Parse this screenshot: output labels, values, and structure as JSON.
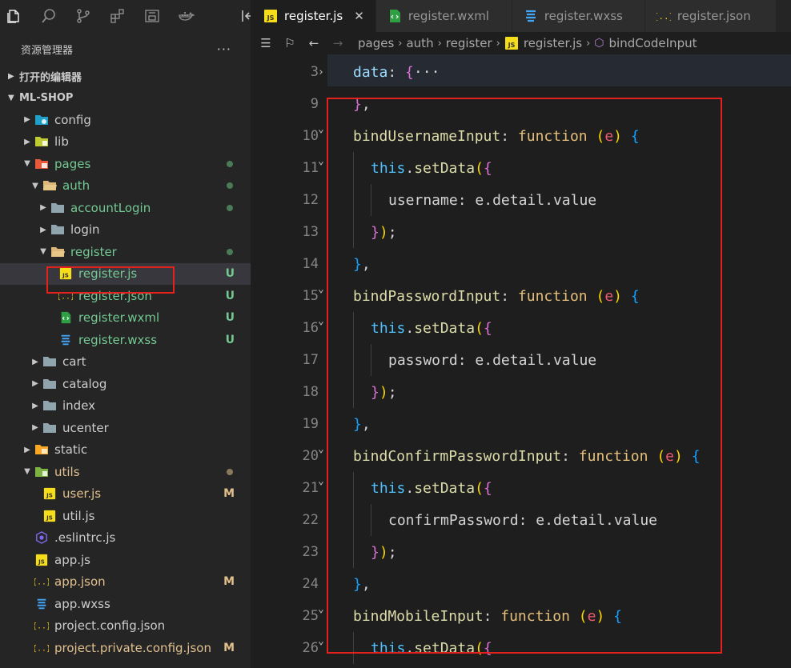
{
  "sidebar": {
    "title": "资源管理器",
    "more": "···",
    "open_editors": "打开的编辑器",
    "project": "ML-SHOP",
    "tree": [
      {
        "label": "config",
        "depth": 0,
        "chev": "▶",
        "icon": "folder-config-icon",
        "color": "plain"
      },
      {
        "label": "lib",
        "depth": 0,
        "chev": "▶",
        "icon": "folder-lib-icon",
        "color": "plain"
      },
      {
        "label": "pages",
        "depth": 0,
        "chev": "▼",
        "icon": "folder-pages-icon",
        "color": "green",
        "status": "dot"
      },
      {
        "label": "auth",
        "depth": 1,
        "chev": "▼",
        "icon": "folder-open-icon",
        "color": "green",
        "status": "dot"
      },
      {
        "label": "accountLogin",
        "depth": 2,
        "chev": "▶",
        "icon": "folder-icon",
        "color": "green",
        "status": "dot"
      },
      {
        "label": "login",
        "depth": 2,
        "chev": "▶",
        "icon": "folder-icon",
        "color": "plain"
      },
      {
        "label": "register",
        "depth": 2,
        "chev": "▼",
        "icon": "folder-open-icon",
        "color": "green",
        "status": "dot"
      },
      {
        "label": "register.js",
        "depth": 3,
        "chev": "",
        "icon": "js-file-icon",
        "color": "green",
        "status": "U",
        "selected": true
      },
      {
        "label": "register.json",
        "depth": 3,
        "chev": "",
        "icon": "json-file-icon",
        "color": "green",
        "status": "U"
      },
      {
        "label": "register.wxml",
        "depth": 3,
        "chev": "",
        "icon": "wxml-file-icon",
        "color": "green",
        "status": "U"
      },
      {
        "label": "register.wxss",
        "depth": 3,
        "chev": "",
        "icon": "css-file-icon",
        "color": "green",
        "status": "U"
      },
      {
        "label": "cart",
        "depth": 1,
        "chev": "▶",
        "icon": "folder-icon",
        "color": "plain"
      },
      {
        "label": "catalog",
        "depth": 1,
        "chev": "▶",
        "icon": "folder-icon",
        "color": "plain"
      },
      {
        "label": "index",
        "depth": 1,
        "chev": "▶",
        "icon": "folder-icon",
        "color": "plain"
      },
      {
        "label": "ucenter",
        "depth": 1,
        "chev": "▶",
        "icon": "folder-icon",
        "color": "plain"
      },
      {
        "label": "static",
        "depth": 0,
        "chev": "▶",
        "icon": "folder-static-icon",
        "color": "plain"
      },
      {
        "label": "utils",
        "depth": 0,
        "chev": "▼",
        "icon": "folder-utils-icon",
        "color": "olive",
        "status": "dot-olive"
      },
      {
        "label": "user.js",
        "depth": 1,
        "chev": "",
        "icon": "js-file-icon",
        "color": "olive",
        "status": "M"
      },
      {
        "label": "util.js",
        "depth": 1,
        "chev": "",
        "icon": "js-file-icon",
        "color": "plain"
      },
      {
        "label": ".eslintrc.js",
        "depth": 0,
        "chev": "",
        "icon": "eslint-icon",
        "color": "plain"
      },
      {
        "label": "app.js",
        "depth": 0,
        "chev": "",
        "icon": "js-file-icon",
        "color": "plain"
      },
      {
        "label": "app.json",
        "depth": 0,
        "chev": "",
        "icon": "json-file-icon",
        "color": "olive",
        "status": "M"
      },
      {
        "label": "app.wxss",
        "depth": 0,
        "chev": "",
        "icon": "css-file-icon",
        "color": "plain"
      },
      {
        "label": "project.config.json",
        "depth": 0,
        "chev": "",
        "icon": "json-file-icon",
        "color": "plain"
      },
      {
        "label": "project.private.config.json",
        "depth": 0,
        "chev": "",
        "icon": "json-file-icon",
        "color": "olive",
        "status": "M"
      }
    ]
  },
  "tabs": [
    {
      "label": "register.js",
      "icon": "js-file-icon",
      "active": true,
      "close": "✕"
    },
    {
      "label": "register.wxml",
      "icon": "wxml-file-icon",
      "active": false
    },
    {
      "label": "register.wxss",
      "icon": "css-file-icon",
      "active": false
    },
    {
      "label": "register.json",
      "icon": "json-file-icon",
      "active": false
    }
  ],
  "breadcrumb": [
    "pages",
    "auth",
    "register",
    "register.js",
    "bindCodeInput"
  ],
  "editor": {
    "lines": [
      {
        "n": "3",
        "fold": "›",
        "indent": 0,
        "tokens": [
          [
            "data",
            "prop"
          ],
          [
            ": ",
            "punc"
          ],
          [
            "{",
            "brace"
          ],
          [
            "···",
            "punc"
          ]
        ]
      },
      {
        "n": "9",
        "fold": "",
        "indent": 0,
        "tokens": [
          [
            "}",
            "brace"
          ],
          [
            ",",
            "punc"
          ]
        ]
      },
      {
        "n": "10",
        "fold": "⌄",
        "indent": 0,
        "tokens": [
          [
            "bindUsernameInput",
            "fn"
          ],
          [
            ": ",
            "punc"
          ],
          [
            "function",
            "kw"
          ],
          [
            " ",
            "punc"
          ],
          [
            "(",
            "paren"
          ],
          [
            "e",
            "param"
          ],
          [
            ")",
            "paren"
          ],
          [
            " ",
            "punc"
          ],
          [
            "{",
            "brace2"
          ]
        ]
      },
      {
        "n": "11",
        "fold": "⌄",
        "indent": 1,
        "tokens": [
          [
            "this",
            "this"
          ],
          [
            ".",
            "punc"
          ],
          [
            "setData",
            "meth"
          ],
          [
            "(",
            "paren"
          ],
          [
            "{",
            "brace"
          ]
        ]
      },
      {
        "n": "12",
        "fold": "",
        "indent": 2,
        "tokens": [
          [
            "username",
            "text"
          ],
          [
            ": ",
            "punc"
          ],
          [
            "e",
            "text"
          ],
          [
            ".",
            "punc"
          ],
          [
            "detail",
            "text"
          ],
          [
            ".",
            "punc"
          ],
          [
            "value",
            "text"
          ]
        ]
      },
      {
        "n": "13",
        "fold": "",
        "indent": 1,
        "tokens": [
          [
            "}",
            "brace"
          ],
          [
            ")",
            "paren"
          ],
          [
            ";",
            "punc"
          ]
        ]
      },
      {
        "n": "14",
        "fold": "",
        "indent": 0,
        "tokens": [
          [
            "}",
            "brace2"
          ],
          [
            ",",
            "punc"
          ]
        ]
      },
      {
        "n": "15",
        "fold": "⌄",
        "indent": 0,
        "tokens": [
          [
            "bindPasswordInput",
            "fn"
          ],
          [
            ": ",
            "punc"
          ],
          [
            "function",
            "kw"
          ],
          [
            " ",
            "punc"
          ],
          [
            "(",
            "paren"
          ],
          [
            "e",
            "param"
          ],
          [
            ")",
            "paren"
          ],
          [
            " ",
            "punc"
          ],
          [
            "{",
            "brace2"
          ]
        ]
      },
      {
        "n": "16",
        "fold": "⌄",
        "indent": 1,
        "tokens": [
          [
            "this",
            "this"
          ],
          [
            ".",
            "punc"
          ],
          [
            "setData",
            "meth"
          ],
          [
            "(",
            "paren"
          ],
          [
            "{",
            "brace"
          ]
        ]
      },
      {
        "n": "17",
        "fold": "",
        "indent": 2,
        "tokens": [
          [
            "password",
            "text"
          ],
          [
            ": ",
            "punc"
          ],
          [
            "e",
            "text"
          ],
          [
            ".",
            "punc"
          ],
          [
            "detail",
            "text"
          ],
          [
            ".",
            "punc"
          ],
          [
            "value",
            "text"
          ]
        ]
      },
      {
        "n": "18",
        "fold": "",
        "indent": 1,
        "tokens": [
          [
            "}",
            "brace"
          ],
          [
            ")",
            "paren"
          ],
          [
            ";",
            "punc"
          ]
        ]
      },
      {
        "n": "19",
        "fold": "",
        "indent": 0,
        "tokens": [
          [
            "}",
            "brace2"
          ],
          [
            ",",
            "punc"
          ]
        ]
      },
      {
        "n": "20",
        "fold": "⌄",
        "indent": 0,
        "tokens": [
          [
            "bindConfirmPasswordInput",
            "fn"
          ],
          [
            ": ",
            "punc"
          ],
          [
            "function",
            "kw"
          ],
          [
            " ",
            "punc"
          ],
          [
            "(",
            "paren"
          ],
          [
            "e",
            "param"
          ],
          [
            ")",
            "paren"
          ],
          [
            " ",
            "punc"
          ],
          [
            "{",
            "brace2"
          ]
        ]
      },
      {
        "n": "21",
        "fold": "⌄",
        "indent": 1,
        "tokens": [
          [
            "this",
            "this"
          ],
          [
            ".",
            "punc"
          ],
          [
            "setData",
            "meth"
          ],
          [
            "(",
            "paren"
          ],
          [
            "{",
            "brace"
          ]
        ]
      },
      {
        "n": "22",
        "fold": "",
        "indent": 2,
        "tokens": [
          [
            "confirmPassword",
            "text"
          ],
          [
            ": ",
            "punc"
          ],
          [
            "e",
            "text"
          ],
          [
            ".",
            "punc"
          ],
          [
            "detail",
            "text"
          ],
          [
            ".",
            "punc"
          ],
          [
            "value",
            "text"
          ]
        ]
      },
      {
        "n": "23",
        "fold": "",
        "indent": 1,
        "tokens": [
          [
            "}",
            "brace"
          ],
          [
            ")",
            "paren"
          ],
          [
            ";",
            "punc"
          ]
        ]
      },
      {
        "n": "24",
        "fold": "",
        "indent": 0,
        "tokens": [
          [
            "}",
            "brace2"
          ],
          [
            ",",
            "punc"
          ]
        ]
      },
      {
        "n": "25",
        "fold": "⌄",
        "indent": 0,
        "tokens": [
          [
            "bindMobileInput",
            "fn"
          ],
          [
            ": ",
            "punc"
          ],
          [
            "function",
            "kw"
          ],
          [
            " ",
            "punc"
          ],
          [
            "(",
            "paren"
          ],
          [
            "e",
            "param"
          ],
          [
            ")",
            "paren"
          ],
          [
            " ",
            "punc"
          ],
          [
            "{",
            "brace2"
          ]
        ]
      },
      {
        "n": "26",
        "fold": "⌄",
        "indent": 1,
        "tokens": [
          [
            "this",
            "this"
          ],
          [
            ".",
            "punc"
          ],
          [
            "setData",
            "meth"
          ],
          [
            "(",
            "paren"
          ],
          [
            "{",
            "brace"
          ]
        ]
      }
    ]
  },
  "colors": {
    "modified": "#e2c08d",
    "untracked": "#73c991",
    "highlight_box": "#e5211e"
  }
}
